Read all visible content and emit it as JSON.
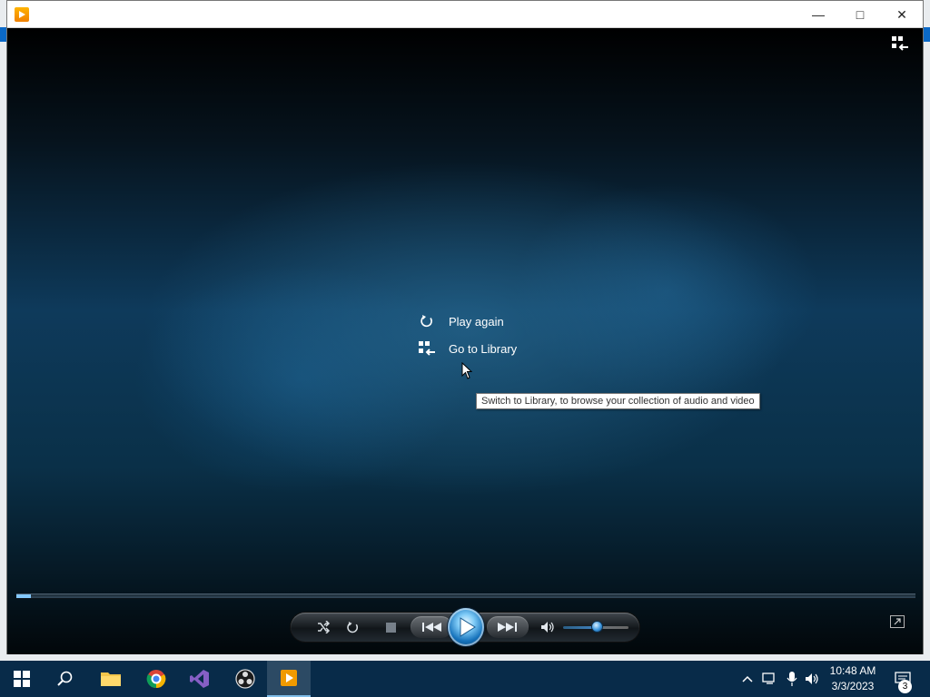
{
  "window": {
    "title": "",
    "controls": {
      "minimize": "—",
      "maximize": "□",
      "close": "✕"
    }
  },
  "player": {
    "menu": {
      "play_again": "Play again",
      "go_to_library": "Go to Library"
    },
    "tooltip": "Switch to Library, to browse your collection of audio and video",
    "seek_progress_percent": 1.6,
    "volume_percent": 48
  },
  "taskbar": {
    "apps": [
      {
        "name": "windows-start",
        "icon": "windows-logo-icon"
      },
      {
        "name": "search",
        "icon": "search-icon"
      },
      {
        "name": "file-explorer",
        "icon": "folder-icon"
      },
      {
        "name": "chrome",
        "icon": "chrome-icon"
      },
      {
        "name": "visual-studio",
        "icon": "visual-studio-icon"
      },
      {
        "name": "obs",
        "icon": "obs-icon"
      },
      {
        "name": "windows-media-player",
        "icon": "media-player-icon"
      }
    ],
    "clock": {
      "time": "10:48 AM",
      "date": "3/3/2023"
    },
    "notification_count": "3"
  },
  "colors": {
    "accent": "#1672bb",
    "taskbar": "#082b49",
    "video_glow": "#2f78a3"
  }
}
